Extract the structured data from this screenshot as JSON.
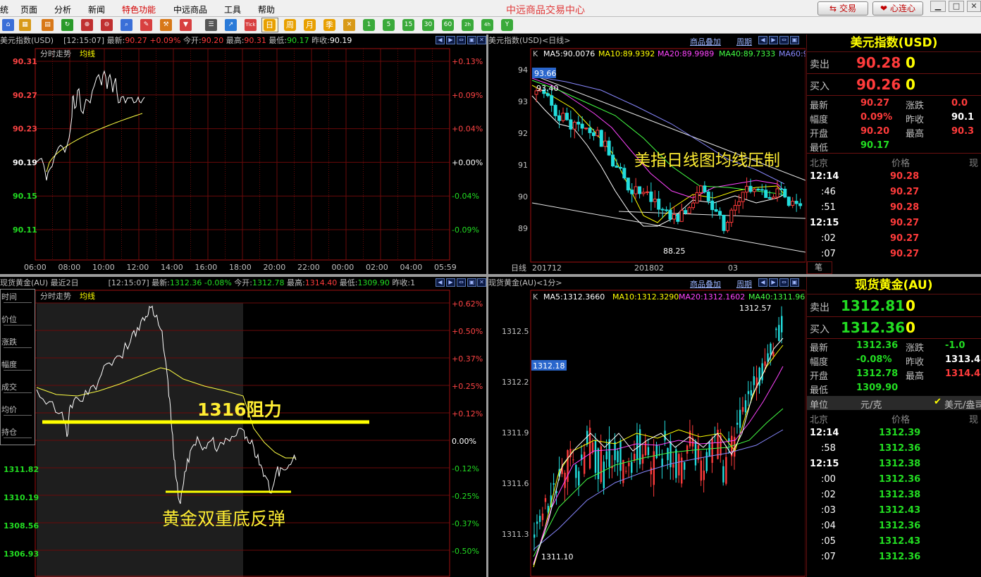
{
  "menu": {
    "items": [
      "统",
      "页面",
      "分析",
      "新闻",
      "特色功能",
      "中远商品",
      "工具",
      "帮助"
    ],
    "active": "特色功能",
    "title": "中远商品交易中心",
    "trade_btn": "交易",
    "connect_btn": "心连心"
  },
  "toolbar": {
    "day_btn": "日",
    "period_labels": [
      "周",
      "月",
      "季",
      "1",
      "5",
      "15",
      "30",
      "60",
      "2h",
      "4h",
      "Y"
    ],
    "tick_label": "Tick"
  },
  "p1": {
    "symbol": "美元指数(USD)",
    "time": "[12:15:07]",
    "last_label": "最新:",
    "last": "90.27",
    "chg": "+0.09%",
    "open_label": "今开:",
    "open": "90.20",
    "high_label": "最高:",
    "high": "90.31",
    "low_label": "最低:",
    "low": "90.17",
    "prev_label": "昨收:",
    "prev": "90.19",
    "sub_title": "分时走势",
    "ma_label": "均线",
    "y_labels": [
      "90.31",
      "90.27",
      "90.23",
      "90.19",
      "90.15",
      "90.11"
    ],
    "pct_labels": [
      "+0.13%",
      "+0.09%",
      "+0.04%",
      "+0.00%",
      "-0.04%",
      "-0.09%"
    ],
    "x_labels": [
      "06:00",
      "08:00",
      "10:00",
      "12:00",
      "14:00",
      "16:00",
      "18:00",
      "20:00",
      "22:00",
      "00:00",
      "02:00",
      "04:00",
      "05:59"
    ]
  },
  "p2": {
    "title": "美元指数(USD)<日线>",
    "overlay_btn": "商品叠加",
    "period_btn": "周期",
    "k_label": "K",
    "ma5": "MA5:90.0076",
    "ma10": "MA10:89.9392",
    "ma20": "MA20:89.9989",
    "ma40": "MA40:89.7333",
    "ma60": "MA60:9",
    "y_labels": [
      "94",
      "93",
      "92",
      "91",
      "90",
      "89"
    ],
    "badge": "93.66",
    "hi_mark": "93.40",
    "lo_mark": "88.25",
    "annotation": "美指日线图均线压制",
    "x_title": "日线",
    "x_labels": [
      "201712",
      "201802",
      "03"
    ]
  },
  "q1": {
    "title": "美元指数(USD)",
    "sell_label": "卖出",
    "sell": "90.28",
    "sell_vol": "0",
    "buy_label": "买入",
    "buy": "90.26",
    "buy_vol": "0",
    "rows": [
      {
        "l1": "最新",
        "v1": "90.27",
        "l2": "涨跌",
        "v2": "0.0"
      },
      {
        "l1": "幅度",
        "v1": "0.09%",
        "l2": "昨收",
        "v2": "90.1"
      },
      {
        "l1": "开盘",
        "v1": "90.20",
        "l2": "最高",
        "v2": "90.3"
      },
      {
        "l1": "最低",
        "v1": "90.17",
        "l2": "",
        "v2": ""
      }
    ],
    "tick_head": [
      "北京",
      "价格",
      "现"
    ],
    "ticks": [
      {
        "t": "12:14",
        "p": "90.28",
        "major": true
      },
      {
        "t": ":46",
        "p": "90.27",
        "major": false
      },
      {
        "t": ":51",
        "p": "90.28",
        "major": false
      },
      {
        "t": "12:15",
        "p": "90.27",
        "major": true
      },
      {
        "t": ":02",
        "p": "90.27",
        "major": false
      },
      {
        "t": ":07",
        "p": "90.27",
        "major": false
      }
    ],
    "tab": "笔"
  },
  "p3": {
    "symbol": "现货黄金(AU)",
    "sub": "最近2日",
    "time": "[12:15:07]",
    "last_label": "最新:",
    "last": "1312.36",
    "chg": "-0.08%",
    "open_label": "今开:",
    "open": "1312.78",
    "high_label": "最高:",
    "high": "1314.40",
    "low_label": "最低:",
    "low": "1309.90",
    "prev_label": "昨收:1",
    "sub_title": "分时走势",
    "ma_label": "均线",
    "side_labels": [
      "时间",
      "价位",
      "涨跌",
      "幅度",
      "成交",
      "均价",
      "持仓"
    ],
    "y_labels": [
      "1311.82",
      "1310.19",
      "1308.56",
      "1306.93"
    ],
    "pct_labels": [
      "+0.62%",
      "+0.50%",
      "+0.37%",
      "+0.25%",
      "+0.12%",
      "0.00%",
      "-0.12%",
      "-0.25%",
      "-0.37%",
      "-0.50%"
    ],
    "annotation_top": "1316阻力",
    "annotation_bottom": "黄金双重底反弹"
  },
  "p4": {
    "title": "现货黄金(AU)<1分>",
    "overlay_btn": "商品叠加",
    "period_btn": "周期",
    "k_label": "K",
    "ma5": "MA5:1312.3660",
    "ma10": "MA10:1312.3290",
    "ma20": "MA20:1312.1602",
    "ma40": "MA40:1311.96",
    "y_labels": [
      "1312.5",
      "1312.2",
      "1311.9",
      "1311.6",
      "1311.3"
    ],
    "badge": "1312.18",
    "hi_mark": "1312.57",
    "lo_mark": "1311.10"
  },
  "q2": {
    "title": "现货黄金(AU)",
    "sell_label": "卖出",
    "sell": "1312.81",
    "sell_vol": "0",
    "buy_label": "买入",
    "buy": "1312.36",
    "buy_vol": "0",
    "rows": [
      {
        "l1": "最新",
        "v1": "1312.36",
        "l2": "涨跌",
        "v2": "-1.0"
      },
      {
        "l1": "幅度",
        "v1": "-0.08%",
        "l2": "昨收",
        "v2": "1313.4"
      },
      {
        "l1": "开盘",
        "v1": "1312.78",
        "l2": "最高",
        "v2": "1314.4"
      },
      {
        "l1": "最低",
        "v1": "1309.90",
        "l2": "",
        "v2": ""
      }
    ],
    "unit_label": "单位",
    "unit": "元/克",
    "check_label": "美元/盎司",
    "tick_head": [
      "北京",
      "价格",
      "现"
    ],
    "ticks": [
      {
        "t": "12:14",
        "p": "1312.39",
        "major": true
      },
      {
        "t": ":58",
        "p": "1312.36",
        "major": false
      },
      {
        "t": "12:15",
        "p": "1312.38",
        "major": true
      },
      {
        "t": ":00",
        "p": "1312.36",
        "major": false
      },
      {
        "t": ":02",
        "p": "1312.38",
        "major": false
      },
      {
        "t": ":03",
        "p": "1312.43",
        "major": false
      },
      {
        "t": ":04",
        "p": "1312.36",
        "major": false
      },
      {
        "t": ":05",
        "p": "1312.43",
        "major": false
      },
      {
        "t": ":07",
        "p": "1312.36",
        "major": false
      }
    ]
  }
}
